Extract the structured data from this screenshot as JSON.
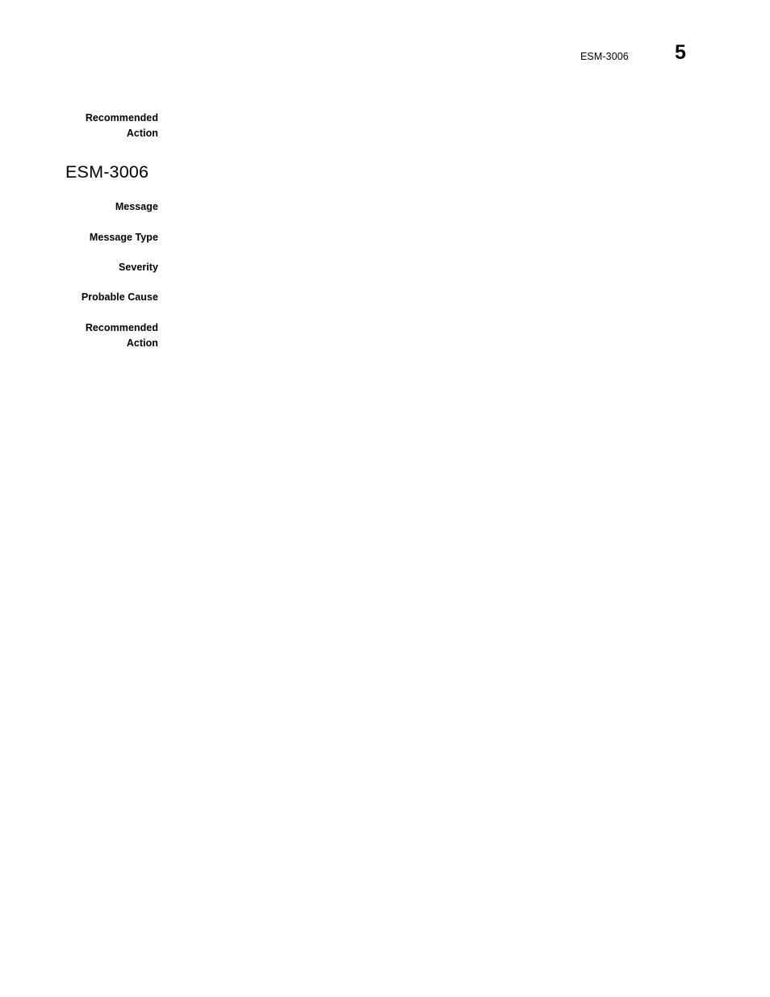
{
  "document": {
    "background_color": "#ffffff",
    "text_color": "#000000"
  },
  "header": {
    "doc_id": "ESM-3006",
    "page_number": "5"
  },
  "continued_section": {
    "fields": [
      {
        "label": "Recommended\nAction",
        "value": ""
      }
    ]
  },
  "sections": [
    {
      "heading": "ESM-3006",
      "fields": [
        {
          "label": "Message",
          "value": ""
        },
        {
          "label": "Message Type",
          "value": ""
        },
        {
          "label": "Severity",
          "value": ""
        },
        {
          "label": "Probable Cause",
          "value": ""
        },
        {
          "label": "Recommended\nAction",
          "value": ""
        }
      ]
    }
  ]
}
